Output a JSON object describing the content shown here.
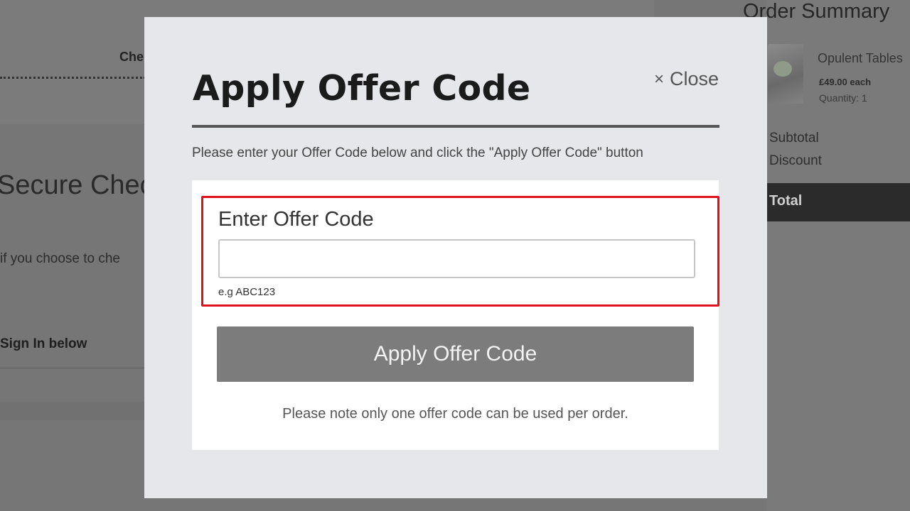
{
  "background": {
    "checkout_tab": "Che",
    "secure_title": "Secure Chec",
    "choose_text": "if you choose to che",
    "signin_text": "Sign In below"
  },
  "order_summary": {
    "title": "Order Summary",
    "product_name": "Opulent Tables",
    "product_price": "£49.00 each",
    "product_qty": "Quantity: 1",
    "subtotal_label": "Subtotal",
    "discount_label": "Discount",
    "total_label": "Total"
  },
  "modal": {
    "title": "Apply Offer Code",
    "close_label": "Close",
    "close_icon": "×",
    "instruction": "Please enter your Offer Code below and click the \"Apply Offer Code\" button",
    "field_label": "Enter Offer Code",
    "field_value": "",
    "field_placeholder": "",
    "field_hint": "e.g ABC123",
    "apply_label": "Apply Offer Code",
    "note": "Please note only one offer code can be used per order.",
    "highlight_color": "#e0101e"
  }
}
